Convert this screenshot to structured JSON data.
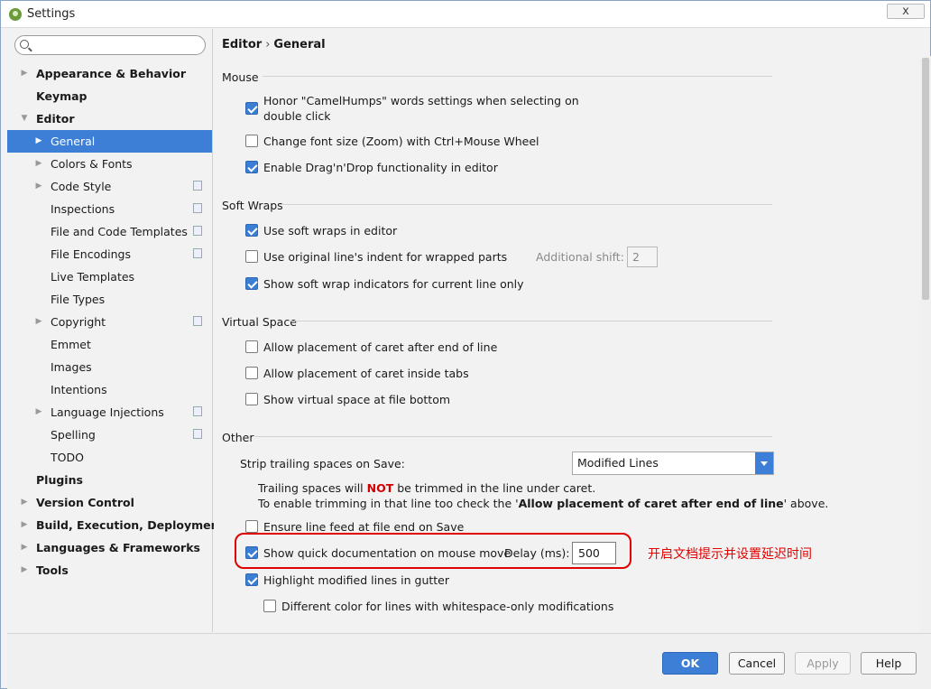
{
  "window": {
    "title": "Settings",
    "close_label": "x"
  },
  "search": {
    "placeholder": ""
  },
  "sidebar": {
    "items": [
      {
        "label": "Appearance & Behavior"
      },
      {
        "label": "Keymap"
      },
      {
        "label": "Editor"
      },
      {
        "label": "General"
      },
      {
        "label": "Colors & Fonts"
      },
      {
        "label": "Code Style"
      },
      {
        "label": "Inspections"
      },
      {
        "label": "File and Code Templates"
      },
      {
        "label": "File Encodings"
      },
      {
        "label": "Live Templates"
      },
      {
        "label": "File Types"
      },
      {
        "label": "Copyright"
      },
      {
        "label": "Emmet"
      },
      {
        "label": "Images"
      },
      {
        "label": "Intentions"
      },
      {
        "label": "Language Injections"
      },
      {
        "label": "Spelling"
      },
      {
        "label": "TODO"
      },
      {
        "label": "Plugins"
      },
      {
        "label": "Version Control"
      },
      {
        "label": "Build, Execution, Deployment"
      },
      {
        "label": "Languages & Frameworks"
      },
      {
        "label": "Tools"
      }
    ]
  },
  "breadcrumb": {
    "parent": "Editor",
    "separator": "›",
    "current": "General"
  },
  "mouse": {
    "title": "Mouse",
    "camelhumps_line1": "Honor \"CamelHumps\" words settings when selecting on",
    "camelhumps_line2": "double click",
    "font_zoom": "Change font size (Zoom) with Ctrl+Mouse Wheel",
    "drag_drop": "Enable Drag'n'Drop functionality in editor"
  },
  "soft_wraps": {
    "title": "Soft Wraps",
    "use_soft_wraps": "Use soft wraps in editor",
    "original_indent": "Use original line's indent for wrapped parts",
    "additional_shift_label": "Additional shift:",
    "additional_shift_value": "2",
    "show_indicators": "Show soft wrap indicators for current line only"
  },
  "virtual_space": {
    "title": "Virtual Space",
    "after_end": "Allow placement of caret after end of line",
    "inside_tabs": "Allow placement of caret inside tabs",
    "file_bottom": "Show virtual space at file bottom"
  },
  "other": {
    "title": "Other",
    "strip_label": "Strip trailing spaces on Save:",
    "strip_value": "Modified Lines",
    "note_1_before": "Trailing spaces will ",
    "note_1_bold": "NOT",
    "note_1_after": " be trimmed in the line under caret.",
    "note_2_before": "To enable trimming in that line too check the '",
    "note_2_bold": "Allow placement of caret after end of line",
    "note_2_after": "' above.",
    "ensure_feed": "Ensure line feed at file end on Save",
    "quick_doc": "Show quick documentation on mouse move",
    "delay_label": "Delay (ms):",
    "delay_value": "500",
    "highlight_modified": "Highlight modified lines in gutter",
    "whitespace_color": "Different color for lines with whitespace-only modifications"
  },
  "annotation": {
    "text": "开启文档提示并设置延迟时间",
    "color": "#e00000"
  },
  "buttons": {
    "ok": "OK",
    "cancel": "Cancel",
    "apply": "Apply",
    "help": "Help"
  },
  "colors": {
    "accent": "#3d7fd6",
    "selected_bg": "#3d7fd6",
    "annotation": "#e00000"
  }
}
